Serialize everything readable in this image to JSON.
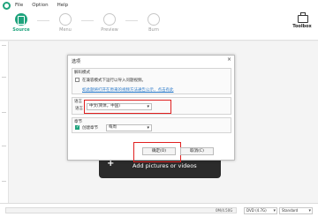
{
  "menu": [
    "File",
    "Option",
    "Help"
  ],
  "steps": [
    {
      "label": "Source",
      "active": true
    },
    {
      "label": "Menu",
      "active": false
    },
    {
      "label": "Preview",
      "active": false
    },
    {
      "label": "Burn",
      "active": false
    }
  ],
  "toolbox": {
    "label": "Toolbox"
  },
  "add_panel": {
    "plus": "+",
    "label": "Add pictures or videos"
  },
  "status": {
    "size_text": "0M/4.50G",
    "progress": 0.0,
    "disc_type": "DVD (4.7G)",
    "quality": "Standard"
  },
  "dialog": {
    "title": "选项",
    "close": "×",
    "decode": {
      "title": "解码模式",
      "checkbox_label": "在兼容模式下运行以导入问题视频。",
      "checked": false,
      "link": "如此题将打开在原来的视频方法通告公示，点击有此"
    },
    "language": {
      "title": "语言",
      "label": "语言",
      "value": "中文(简体，中国)"
    },
    "chapter": {
      "title": "章节",
      "checkbox_label": "创建章节",
      "checked": true,
      "value": "每周"
    },
    "ok": "确定(O)",
    "cancel": "取消(C)"
  },
  "colors": {
    "accent": "#1ea37c",
    "highlight": "#e02020",
    "panel": "#2b2b2b"
  }
}
